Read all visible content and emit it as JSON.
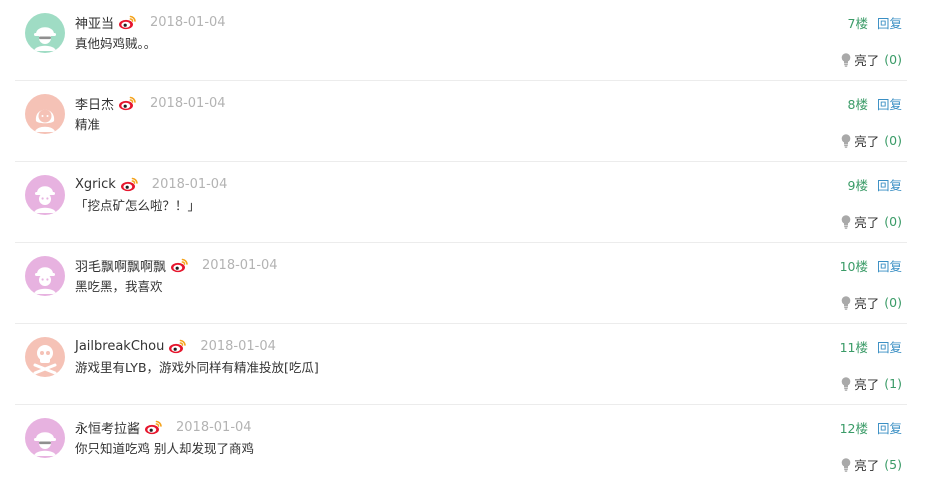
{
  "comments": [
    {
      "user": "神亚当",
      "date": "2018-01-04",
      "text": "真他妈鸡贼。。",
      "floor": "7楼",
      "reply": "回复",
      "like_label": "亮了",
      "like_count": "(0)",
      "avatar_color": "#9fdcc4",
      "avatar_icon": "helmet-face-icon"
    },
    {
      "user": "李日杰",
      "date": "2018-01-04",
      "text": "精准",
      "floor": "8楼",
      "reply": "回复",
      "like_label": "亮了",
      "like_count": "(0)",
      "avatar_color": "#f5c2b6",
      "avatar_icon": "girl-face-icon"
    },
    {
      "user": "Xgrick",
      "date": "2018-01-04",
      "text": "「挖点矿怎么啦？！」",
      "floor": "9楼",
      "reply": "回复",
      "like_label": "亮了",
      "like_count": "(0)",
      "avatar_color": "#e7b2e0",
      "avatar_icon": "hardhat-face-icon"
    },
    {
      "user": "羽毛飘啊飘啊飘",
      "date": "2018-01-04",
      "text": "黑吃黑，我喜欢",
      "floor": "10楼",
      "reply": "回复",
      "like_label": "亮了",
      "like_count": "(0)",
      "avatar_color": "#e7b2e0",
      "avatar_icon": "hardhat-face-icon"
    },
    {
      "user": "JailbreakChou",
      "date": "2018-01-04",
      "text": "游戏里有LYB，游戏外同样有精准投放[吃瓜]",
      "floor": "11楼",
      "reply": "回复",
      "like_label": "亮了",
      "like_count": "(1)",
      "avatar_color": "#f5c2b6",
      "avatar_icon": "skull-icon"
    },
    {
      "user": "永恒考拉酱",
      "date": "2018-01-04",
      "text": "你只知道吃鸡 别人却发现了商鸡",
      "floor": "12楼",
      "reply": "回复",
      "like_label": "亮了",
      "like_count": "(5)",
      "avatar_color": "#e7b2e0",
      "avatar_icon": "helmet-face-icon"
    }
  ],
  "colors": {
    "floor": "#3a9b67",
    "reply": "#3a8fc4",
    "date": "#b3b3b3",
    "like_count": "#3a9b67"
  },
  "icons": {
    "weibo": "weibo-icon",
    "like": "lightbulb-icon"
  }
}
